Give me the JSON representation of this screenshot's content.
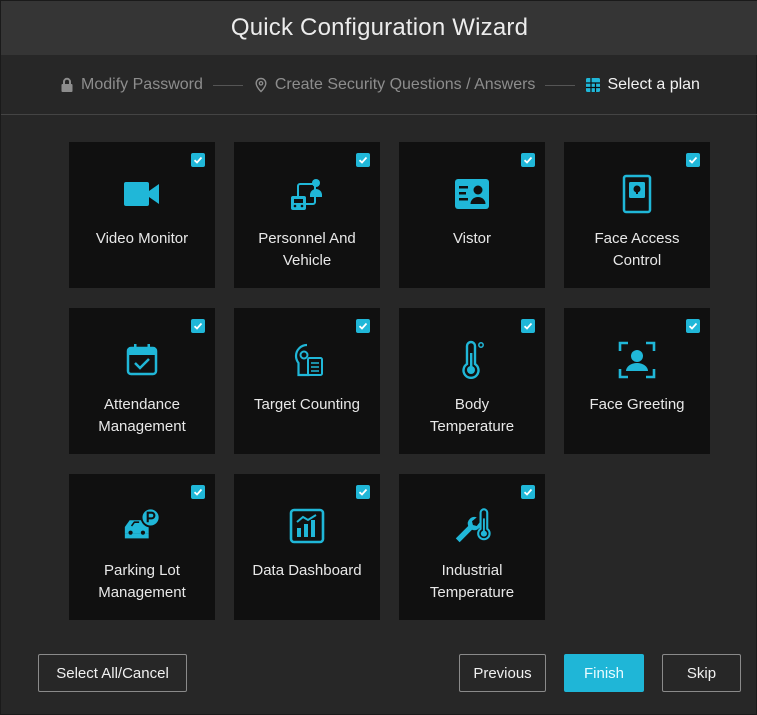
{
  "window": {
    "title": "Quick Configuration Wizard"
  },
  "steps": [
    {
      "label": "Modify Password",
      "icon": "lock-icon",
      "active": false
    },
    {
      "label": "Create Security Questions / Answers",
      "icon": "location-pin-icon",
      "active": false
    },
    {
      "label": "Select a plan",
      "icon": "grid-plan-icon",
      "active": true
    }
  ],
  "tiles": [
    {
      "label": "Video Monitor",
      "icon": "video-camera-icon",
      "checked": true
    },
    {
      "label": "Personnel And\nVehicle",
      "icon": "person-vehicle-icon",
      "checked": true
    },
    {
      "label": "Vistor",
      "icon": "id-card-icon",
      "checked": true
    },
    {
      "label": "Face Access\nControl",
      "icon": "door-lock-icon",
      "checked": true
    },
    {
      "label": "Attendance\nManagement",
      "icon": "calendar-check-icon",
      "checked": true
    },
    {
      "label": "Target Counting",
      "icon": "head-counting-icon",
      "checked": true
    },
    {
      "label": "Body\nTemperature",
      "icon": "thermometer-icon",
      "checked": true
    },
    {
      "label": "Face Greeting",
      "icon": "face-frame-icon",
      "checked": true
    },
    {
      "label": "Parking Lot\nManagement",
      "icon": "car-parking-icon",
      "checked": true
    },
    {
      "label": "Data Dashboard",
      "icon": "chart-dashboard-icon",
      "checked": true
    },
    {
      "label": "Industrial\nTemperature",
      "icon": "wrench-thermometer-icon",
      "checked": true
    }
  ],
  "buttons": {
    "select_all": "Select All/Cancel",
    "previous": "Previous",
    "finish": "Finish",
    "skip": "Skip"
  },
  "colors": {
    "accent": "#1fb6d7",
    "tile_bg": "#101010",
    "window_bg": "#272727"
  }
}
